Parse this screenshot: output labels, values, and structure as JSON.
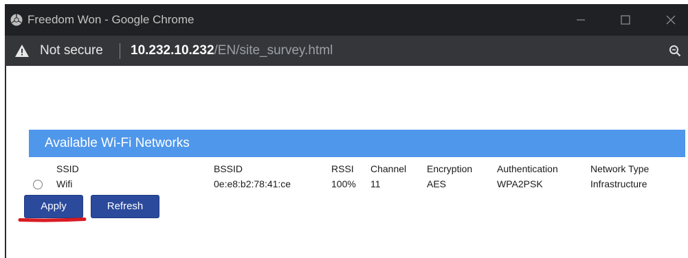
{
  "window": {
    "title": "Freedom Won - Google Chrome"
  },
  "addressbar": {
    "security_label": "Not secure",
    "url_host": "10.232.10.232",
    "url_path": "/EN/site_survey.html"
  },
  "page": {
    "section_title": "Available Wi-Fi Networks",
    "table": {
      "headers": [
        "SSID",
        "BSSID",
        "RSSI",
        "Channel",
        "Encryption",
        "Authentication",
        "Network Type"
      ],
      "rows": [
        [
          "Wifi",
          "0e:e8:b2:78:41:ce",
          "100%",
          "11",
          "AES",
          "WPA2PSK",
          "Infrastructure"
        ]
      ]
    },
    "buttons": {
      "apply": "Apply",
      "refresh": "Refresh"
    }
  },
  "colors": {
    "titlebar": "#202124",
    "addressbar": "#35363a",
    "header_bar": "#4f97eb",
    "button": "#2b4a9c",
    "annotation_underline": "#d81b23"
  },
  "icons": {
    "app": "chrome-icon",
    "security": "warning-icon",
    "zoom": "zoom-icon",
    "minimize": "minimize-icon",
    "maximize": "maximize-icon",
    "close": "close-icon"
  }
}
